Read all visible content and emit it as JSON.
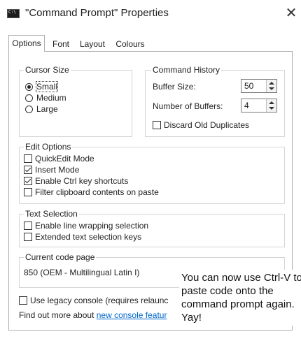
{
  "window": {
    "title": "\"Command Prompt\" Properties",
    "close_glyph": "✕"
  },
  "tabs": [
    {
      "label": "Options",
      "active": true
    },
    {
      "label": "Font"
    },
    {
      "label": "Layout"
    },
    {
      "label": "Colours"
    }
  ],
  "cursor_size": {
    "title": "Cursor Size",
    "options": [
      {
        "label": "Small",
        "selected": true
      },
      {
        "label": "Medium"
      },
      {
        "label": "Large"
      }
    ]
  },
  "command_history": {
    "title": "Command History",
    "buffer_size_label": "Buffer Size:",
    "buffer_size_value": "50",
    "num_buffers_label": "Number of Buffers:",
    "num_buffers_value": "4",
    "discard_label": "Discard Old Duplicates",
    "discard_checked": false
  },
  "edit_options": {
    "title": "Edit Options",
    "items": [
      {
        "label": "QuickEdit Mode",
        "checked": false
      },
      {
        "label": "Insert Mode",
        "checked": true
      },
      {
        "label": "Enable Ctrl key shortcuts",
        "checked": true
      },
      {
        "label": "Filter clipboard contents on paste",
        "checked": false
      }
    ]
  },
  "text_selection": {
    "title": "Text Selection",
    "items": [
      {
        "label": "Enable line wrapping selection",
        "checked": false
      },
      {
        "label": "Extended text selection keys",
        "checked": false
      }
    ]
  },
  "code_page": {
    "title": "Current code page",
    "value": "850   (OEM - Multilingual Latin I)"
  },
  "legacy": {
    "label": "Use legacy console (requires relaunc",
    "checked": false
  },
  "find_more": {
    "prefix": "Find out more about ",
    "link": "new console featur"
  },
  "caption": "You can now use Ctrl-V to paste code onto the command prompt again. Yay!"
}
